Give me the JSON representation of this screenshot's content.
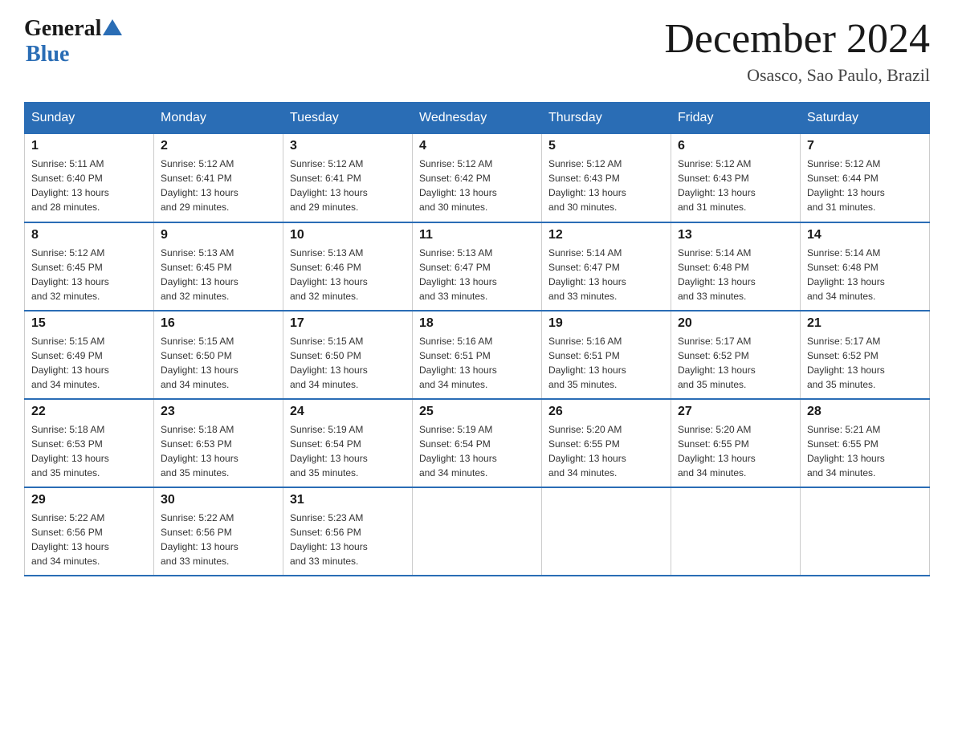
{
  "header": {
    "logo_general": "General",
    "logo_blue": "Blue",
    "month_title": "December 2024",
    "location": "Osasco, Sao Paulo, Brazil"
  },
  "days_of_week": [
    "Sunday",
    "Monday",
    "Tuesday",
    "Wednesday",
    "Thursday",
    "Friday",
    "Saturday"
  ],
  "weeks": [
    [
      {
        "day": "1",
        "sunrise": "5:11 AM",
        "sunset": "6:40 PM",
        "daylight": "13 hours and 28 minutes."
      },
      {
        "day": "2",
        "sunrise": "5:12 AM",
        "sunset": "6:41 PM",
        "daylight": "13 hours and 29 minutes."
      },
      {
        "day": "3",
        "sunrise": "5:12 AM",
        "sunset": "6:41 PM",
        "daylight": "13 hours and 29 minutes."
      },
      {
        "day": "4",
        "sunrise": "5:12 AM",
        "sunset": "6:42 PM",
        "daylight": "13 hours and 30 minutes."
      },
      {
        "day": "5",
        "sunrise": "5:12 AM",
        "sunset": "6:43 PM",
        "daylight": "13 hours and 30 minutes."
      },
      {
        "day": "6",
        "sunrise": "5:12 AM",
        "sunset": "6:43 PM",
        "daylight": "13 hours and 31 minutes."
      },
      {
        "day": "7",
        "sunrise": "5:12 AM",
        "sunset": "6:44 PM",
        "daylight": "13 hours and 31 minutes."
      }
    ],
    [
      {
        "day": "8",
        "sunrise": "5:12 AM",
        "sunset": "6:45 PM",
        "daylight": "13 hours and 32 minutes."
      },
      {
        "day": "9",
        "sunrise": "5:13 AM",
        "sunset": "6:45 PM",
        "daylight": "13 hours and 32 minutes."
      },
      {
        "day": "10",
        "sunrise": "5:13 AM",
        "sunset": "6:46 PM",
        "daylight": "13 hours and 32 minutes."
      },
      {
        "day": "11",
        "sunrise": "5:13 AM",
        "sunset": "6:47 PM",
        "daylight": "13 hours and 33 minutes."
      },
      {
        "day": "12",
        "sunrise": "5:14 AM",
        "sunset": "6:47 PM",
        "daylight": "13 hours and 33 minutes."
      },
      {
        "day": "13",
        "sunrise": "5:14 AM",
        "sunset": "6:48 PM",
        "daylight": "13 hours and 33 minutes."
      },
      {
        "day": "14",
        "sunrise": "5:14 AM",
        "sunset": "6:48 PM",
        "daylight": "13 hours and 34 minutes."
      }
    ],
    [
      {
        "day": "15",
        "sunrise": "5:15 AM",
        "sunset": "6:49 PM",
        "daylight": "13 hours and 34 minutes."
      },
      {
        "day": "16",
        "sunrise": "5:15 AM",
        "sunset": "6:50 PM",
        "daylight": "13 hours and 34 minutes."
      },
      {
        "day": "17",
        "sunrise": "5:15 AM",
        "sunset": "6:50 PM",
        "daylight": "13 hours and 34 minutes."
      },
      {
        "day": "18",
        "sunrise": "5:16 AM",
        "sunset": "6:51 PM",
        "daylight": "13 hours and 34 minutes."
      },
      {
        "day": "19",
        "sunrise": "5:16 AM",
        "sunset": "6:51 PM",
        "daylight": "13 hours and 35 minutes."
      },
      {
        "day": "20",
        "sunrise": "5:17 AM",
        "sunset": "6:52 PM",
        "daylight": "13 hours and 35 minutes."
      },
      {
        "day": "21",
        "sunrise": "5:17 AM",
        "sunset": "6:52 PM",
        "daylight": "13 hours and 35 minutes."
      }
    ],
    [
      {
        "day": "22",
        "sunrise": "5:18 AM",
        "sunset": "6:53 PM",
        "daylight": "13 hours and 35 minutes."
      },
      {
        "day": "23",
        "sunrise": "5:18 AM",
        "sunset": "6:53 PM",
        "daylight": "13 hours and 35 minutes."
      },
      {
        "day": "24",
        "sunrise": "5:19 AM",
        "sunset": "6:54 PM",
        "daylight": "13 hours and 35 minutes."
      },
      {
        "day": "25",
        "sunrise": "5:19 AM",
        "sunset": "6:54 PM",
        "daylight": "13 hours and 34 minutes."
      },
      {
        "day": "26",
        "sunrise": "5:20 AM",
        "sunset": "6:55 PM",
        "daylight": "13 hours and 34 minutes."
      },
      {
        "day": "27",
        "sunrise": "5:20 AM",
        "sunset": "6:55 PM",
        "daylight": "13 hours and 34 minutes."
      },
      {
        "day": "28",
        "sunrise": "5:21 AM",
        "sunset": "6:55 PM",
        "daylight": "13 hours and 34 minutes."
      }
    ],
    [
      {
        "day": "29",
        "sunrise": "5:22 AM",
        "sunset": "6:56 PM",
        "daylight": "13 hours and 34 minutes."
      },
      {
        "day": "30",
        "sunrise": "5:22 AM",
        "sunset": "6:56 PM",
        "daylight": "13 hours and 33 minutes."
      },
      {
        "day": "31",
        "sunrise": "5:23 AM",
        "sunset": "6:56 PM",
        "daylight": "13 hours and 33 minutes."
      },
      null,
      null,
      null,
      null
    ]
  ],
  "labels": {
    "sunrise": "Sunrise:",
    "sunset": "Sunset:",
    "daylight": "Daylight:"
  }
}
